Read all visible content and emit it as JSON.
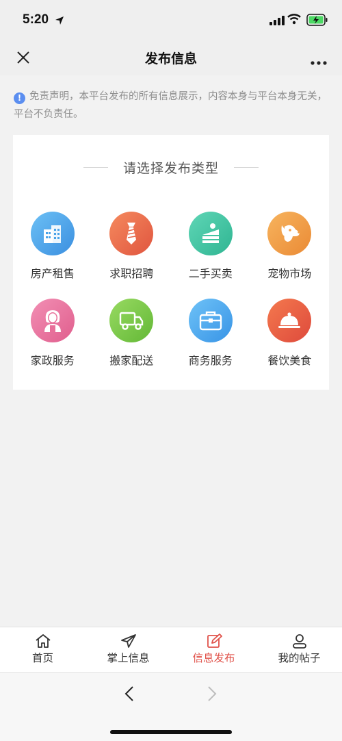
{
  "status_bar": {
    "time": "5:20"
  },
  "nav": {
    "title": "发布信息"
  },
  "disclaimer": {
    "text": "免责声明，本平台发布的所有信息展示，内容本身与平台本身无关，平台不负责任。"
  },
  "card": {
    "title": "请选择发布类型",
    "categories": [
      {
        "label": "房产租售",
        "icon": "building-icon",
        "color": "#4aa3e8"
      },
      {
        "label": "求职招聘",
        "icon": "tie-icon",
        "color": "#e8674a"
      },
      {
        "label": "二手买卖",
        "icon": "cake-icon",
        "color": "#3ec4a4"
      },
      {
        "label": "宠物市场",
        "icon": "dog-icon",
        "color": "#f0a04a"
      },
      {
        "label": "家政服务",
        "icon": "housekeeper-icon",
        "color": "#e8709a"
      },
      {
        "label": "搬家配送",
        "icon": "truck-icon",
        "color": "#7cc84a"
      },
      {
        "label": "商务服务",
        "icon": "briefcase-icon",
        "color": "#4aaaf0"
      },
      {
        "label": "餐饮美食",
        "icon": "food-cloche-icon",
        "color": "#e8584a"
      }
    ]
  },
  "tabs": [
    {
      "label": "首页",
      "icon": "home-icon"
    },
    {
      "label": "掌上信息",
      "icon": "paper-plane-icon"
    },
    {
      "label": "信息发布",
      "icon": "edit-icon",
      "active": true
    },
    {
      "label": "我的帖子",
      "icon": "user-icon"
    }
  ],
  "colors": {
    "accent": "#e0524a",
    "info": "#5b8ef0"
  }
}
